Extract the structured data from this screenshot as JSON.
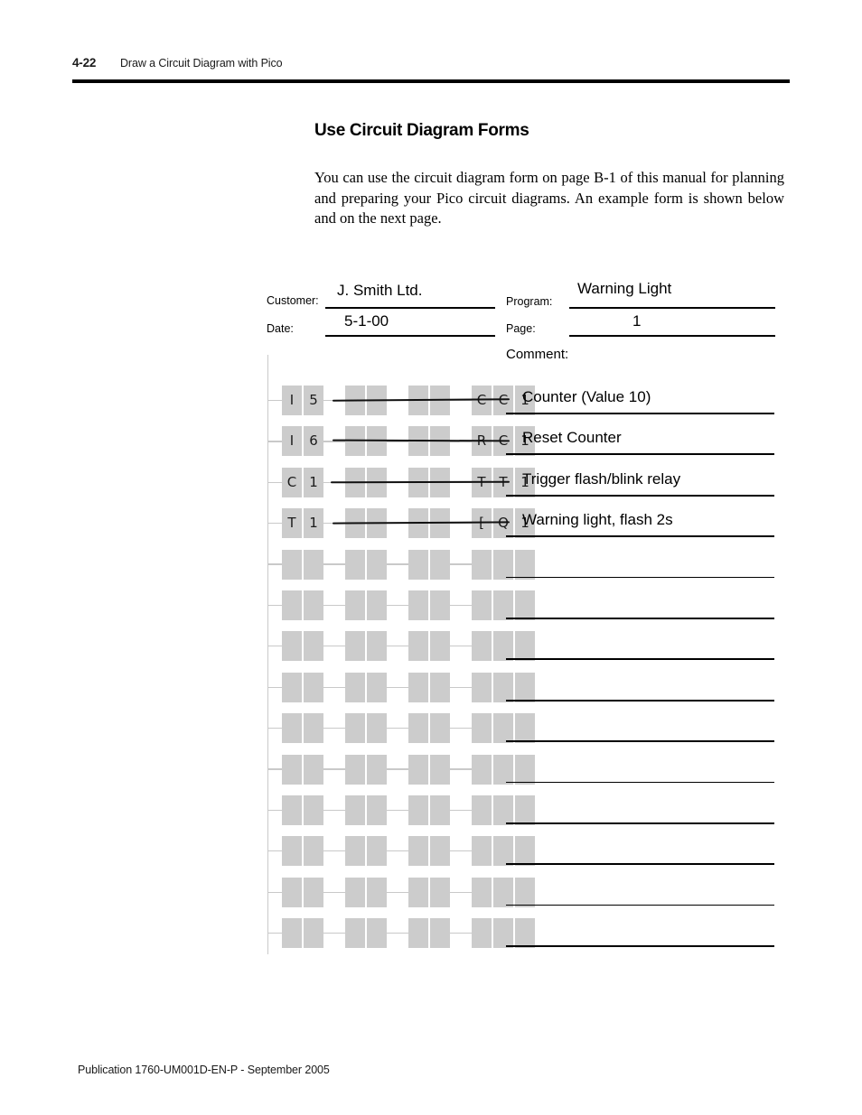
{
  "header": {
    "page_number": "4-22",
    "chapter_title": "Draw a Circuit Diagram with Pico"
  },
  "section": {
    "title": "Use Circuit Diagram Forms",
    "body": "You can use the circuit diagram form on page B-1 of this manual for planning and preparing your Pico circuit diagrams. An example form is shown below and on the next page."
  },
  "form": {
    "labels": {
      "customer": "Customer:",
      "date": "Date:",
      "program": "Program:",
      "page": "Page:",
      "comment": "Comment:"
    },
    "values": {
      "customer": "J. Smith Ltd.",
      "date": "5-1-00",
      "program": "Warning Light",
      "page": "1"
    }
  },
  "circuit": {
    "row_count": 14,
    "rows": [
      {
        "filled": true,
        "contacts": [
          "I",
          "5"
        ],
        "middle": [
          "",
          "",
          "",
          ""
        ],
        "coil": [
          "C",
          "C",
          "1"
        ],
        "comment": "Counter (Value 10)"
      },
      {
        "filled": true,
        "contacts": [
          "I",
          "6"
        ],
        "middle": [
          "",
          "",
          "",
          ""
        ],
        "coil": [
          "R",
          "C",
          "1"
        ],
        "comment": "Reset Counter"
      },
      {
        "filled": true,
        "contacts": [
          "C",
          "1"
        ],
        "middle": [
          "",
          "",
          "",
          ""
        ],
        "coil": [
          "T",
          "T",
          "1"
        ],
        "comment": "Trigger flash/blink relay"
      },
      {
        "filled": true,
        "contacts": [
          "T",
          "1"
        ],
        "middle": [
          "",
          "",
          "",
          ""
        ],
        "coil": [
          "[",
          "Q",
          "1"
        ],
        "comment": "Warning light, flash 2s"
      },
      {
        "filled": false,
        "contacts": [
          "",
          ""
        ],
        "middle": [
          "",
          "",
          "",
          ""
        ],
        "coil": [
          "",
          "",
          ""
        ],
        "comment": ""
      },
      {
        "filled": false,
        "contacts": [
          "",
          ""
        ],
        "middle": [
          "",
          "",
          "",
          ""
        ],
        "coil": [
          "",
          "",
          ""
        ],
        "comment": ""
      },
      {
        "filled": false,
        "contacts": [
          "",
          ""
        ],
        "middle": [
          "",
          "",
          "",
          ""
        ],
        "coil": [
          "",
          "",
          ""
        ],
        "comment": ""
      },
      {
        "filled": false,
        "contacts": [
          "",
          ""
        ],
        "middle": [
          "",
          "",
          "",
          ""
        ],
        "coil": [
          "",
          "",
          ""
        ],
        "comment": ""
      },
      {
        "filled": false,
        "contacts": [
          "",
          ""
        ],
        "middle": [
          "",
          "",
          "",
          ""
        ],
        "coil": [
          "",
          "",
          ""
        ],
        "comment": ""
      },
      {
        "filled": false,
        "contacts": [
          "",
          ""
        ],
        "middle": [
          "",
          "",
          "",
          ""
        ],
        "coil": [
          "",
          "",
          ""
        ],
        "comment": ""
      },
      {
        "filled": false,
        "contacts": [
          "",
          ""
        ],
        "middle": [
          "",
          "",
          "",
          ""
        ],
        "coil": [
          "",
          "",
          ""
        ],
        "comment": ""
      },
      {
        "filled": false,
        "contacts": [
          "",
          ""
        ],
        "middle": [
          "",
          "",
          "",
          ""
        ],
        "coil": [
          "",
          "",
          ""
        ],
        "comment": ""
      },
      {
        "filled": false,
        "contacts": [
          "",
          ""
        ],
        "middle": [
          "",
          "",
          "",
          ""
        ],
        "coil": [
          "",
          "",
          ""
        ],
        "comment": ""
      },
      {
        "filled": false,
        "contacts": [
          "",
          ""
        ],
        "middle": [
          "",
          "",
          "",
          ""
        ],
        "coil": [
          "",
          "",
          ""
        ],
        "comment": ""
      }
    ]
  },
  "footer": {
    "publication": "Publication 1760-UM001D-EN-P - September 2005"
  },
  "colors": {
    "cell_fill": "#cccccc",
    "rail": "#c9c9c9",
    "rule": "#000000"
  }
}
